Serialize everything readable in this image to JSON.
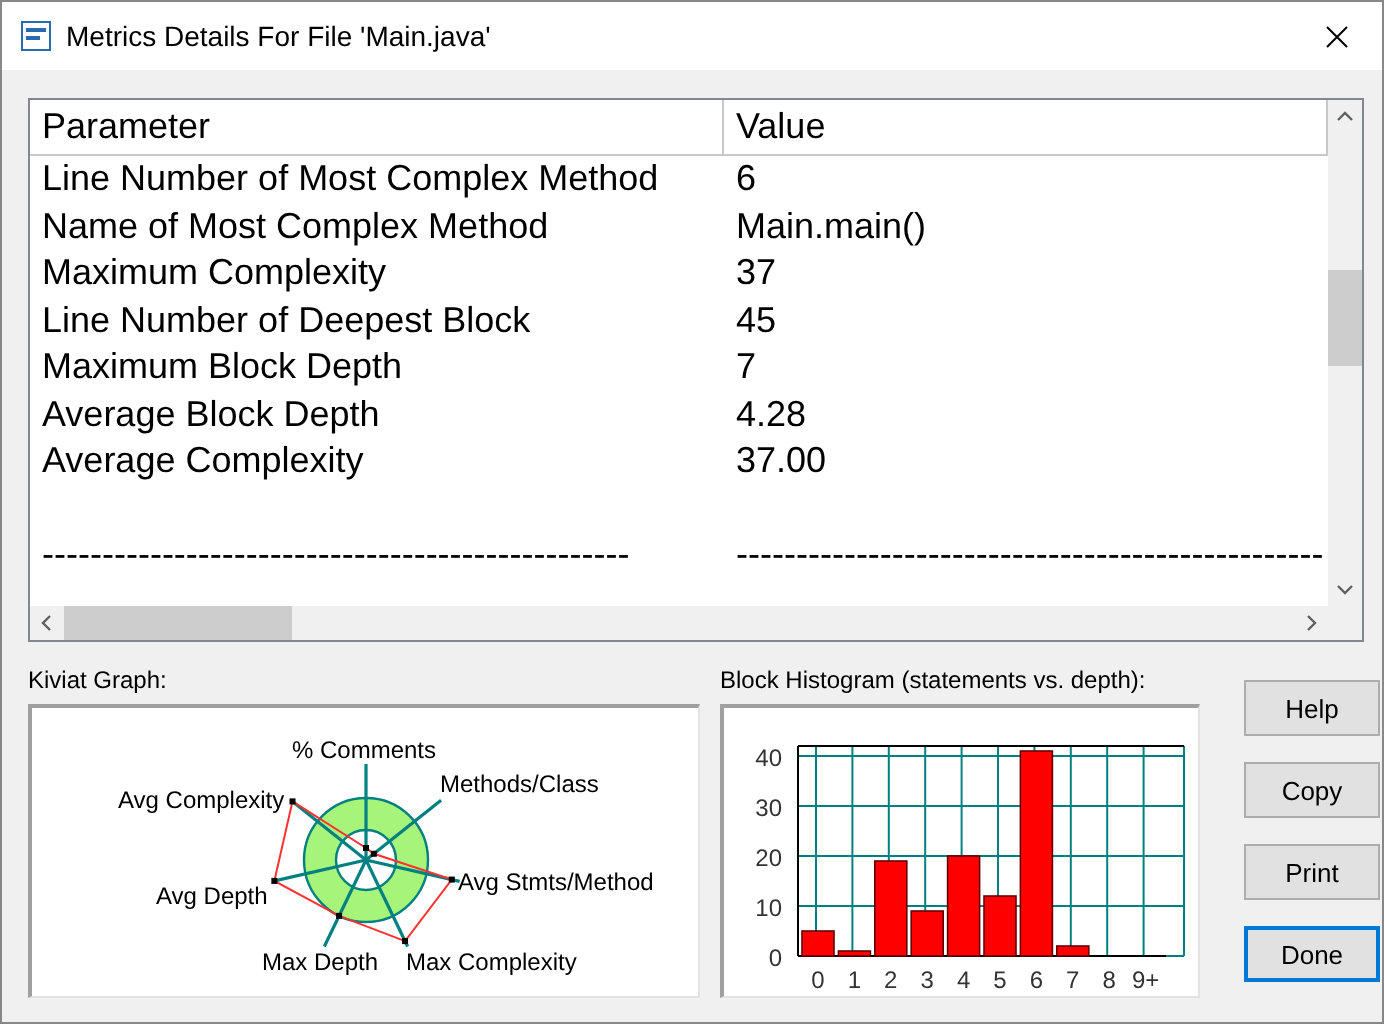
{
  "window": {
    "title": "Metrics Details For File 'Main.java'"
  },
  "table": {
    "columns": [
      "Parameter",
      "Value"
    ],
    "rows": [
      {
        "kind": "data",
        "cells": [
          "Line Number of Most Complex Method",
          "6"
        ]
      },
      {
        "kind": "data",
        "cells": [
          "Name of Most Complex Method",
          "Main.main()"
        ]
      },
      {
        "kind": "data",
        "cells": [
          "Maximum Complexity",
          "37"
        ]
      },
      {
        "kind": "data",
        "cells": [
          "Line Number of Deepest Block",
          "45"
        ]
      },
      {
        "kind": "data",
        "cells": [
          "Maximum Block Depth",
          "7"
        ]
      },
      {
        "kind": "data",
        "cells": [
          "Average Block Depth",
          "4.28"
        ]
      },
      {
        "kind": "data",
        "cells": [
          "Average Complexity",
          "37.00"
        ]
      },
      {
        "kind": "blank"
      },
      {
        "kind": "data",
        "cells": [
          "-------------------------------------------------",
          "-------------------------------------------------"
        ]
      }
    ]
  },
  "kiviat": {
    "label": "Kiviat Graph:",
    "axes": [
      "% Comments",
      "Methods/Class",
      "Avg Complexity",
      "Avg Stmts/Method",
      "Avg Depth",
      "Max Depth",
      "Max Complexity"
    ]
  },
  "histogram": {
    "label": "Block Histogram (statements vs. depth):",
    "chart_data": {
      "type": "bar",
      "categories": [
        "0",
        "1",
        "2",
        "3",
        "4",
        "5",
        "6",
        "7",
        "8",
        "9+"
      ],
      "series": [
        {
          "color": "#ff0000",
          "values": [
            5,
            1,
            19,
            9,
            20,
            12,
            41,
            2,
            0,
            0
          ]
        }
      ],
      "ylim": [
        0,
        42
      ],
      "yticks": [
        0,
        10,
        20,
        30,
        40
      ],
      "grid": true
    }
  },
  "buttons": [
    "Help",
    "Copy",
    "Print",
    "Done"
  ]
}
